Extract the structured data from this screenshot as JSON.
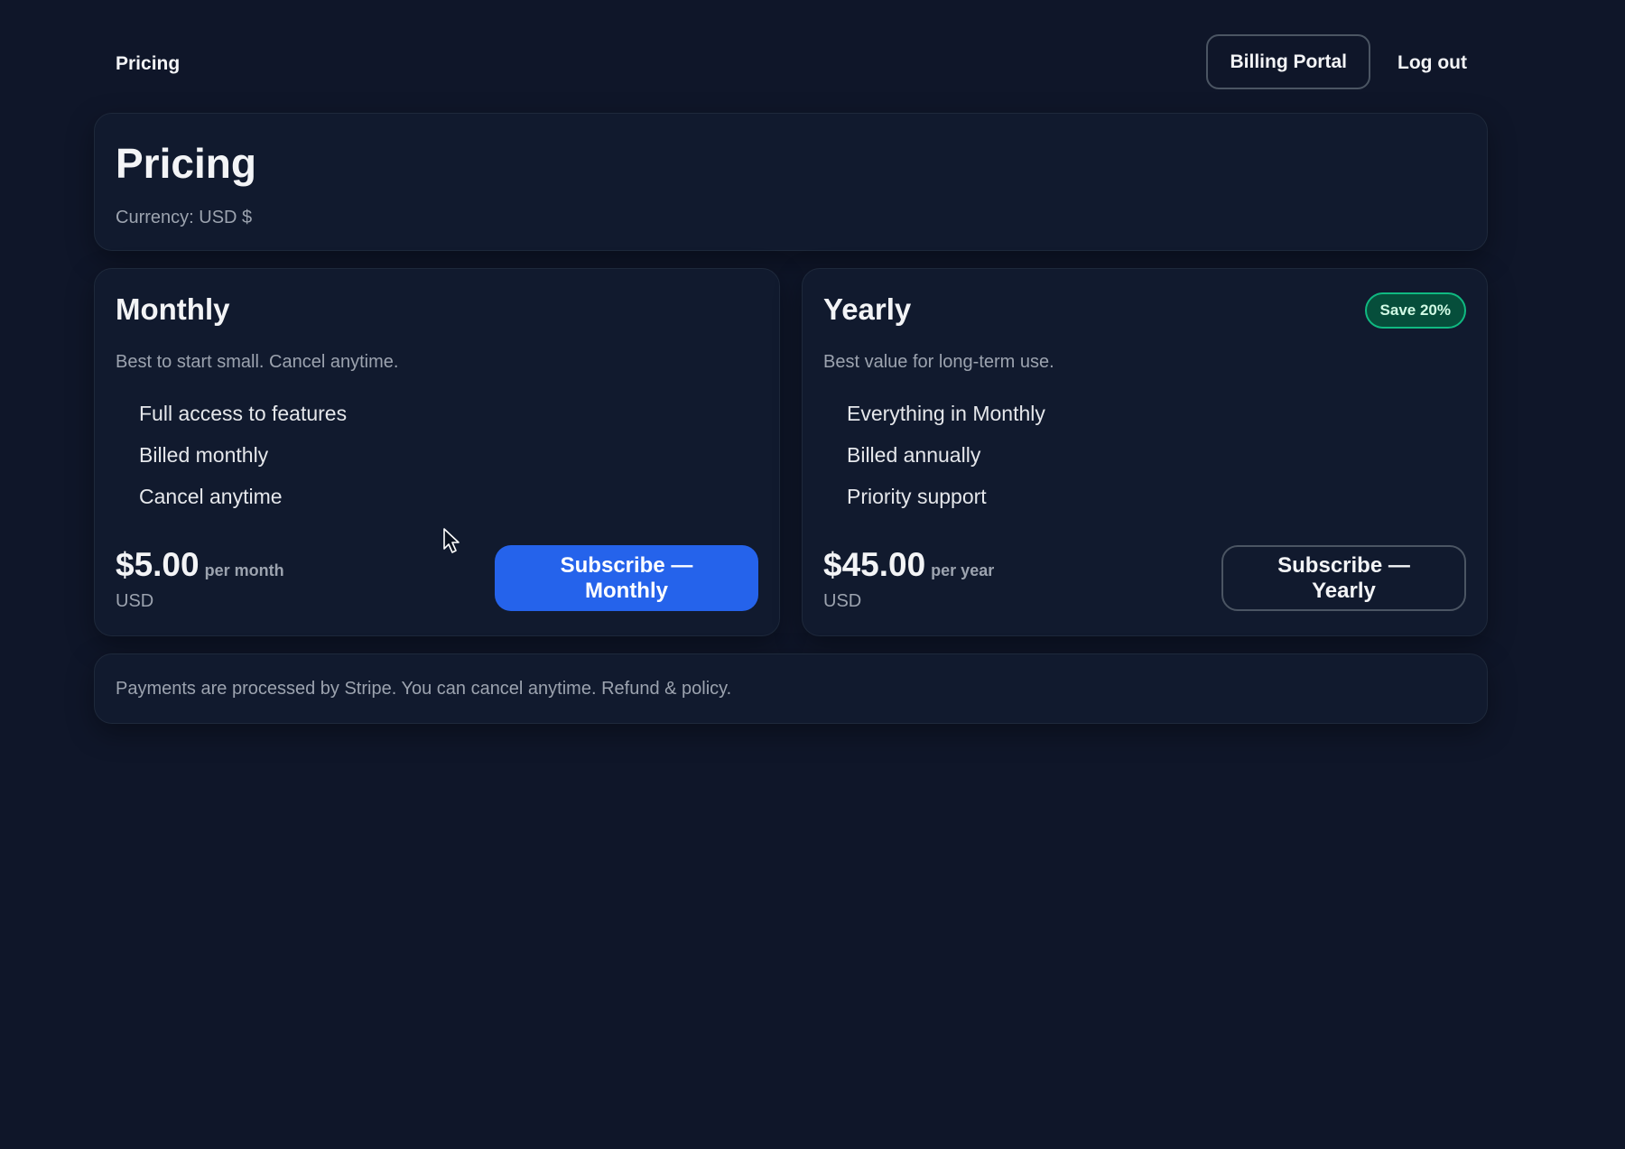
{
  "nav": {
    "brand": "Pricing",
    "billing_portal": "Billing Portal",
    "logout": "Log out"
  },
  "hero": {
    "title": "Pricing",
    "currency_label": "Currency: USD $"
  },
  "plans": [
    {
      "name": "Monthly",
      "description": "Best to start small. Cancel anytime.",
      "features": [
        "Full access to features",
        "Billed monthly",
        "Cancel anytime"
      ],
      "price": "$5.00",
      "period": "per month",
      "currency": "USD",
      "cta": "Subscribe — Monthly",
      "cta_style": "primary"
    },
    {
      "name": "Yearly",
      "badge": "Save 20%",
      "description": "Best value for long-term use.",
      "features": [
        "Everything in Monthly",
        "Billed annually",
        "Priority support"
      ],
      "price": "$45.00",
      "period": "per year",
      "currency": "USD",
      "cta": "Subscribe — Yearly",
      "cta_style": "outline"
    }
  ],
  "footer": {
    "note": "Payments are processed by Stripe. You can cancel anytime. Refund & policy."
  },
  "colors": {
    "background": "#0f1629",
    "card": "#111a2e",
    "primary": "#2563eb",
    "badge_bg": "#064e3b",
    "badge_border": "#10b981"
  },
  "icons": {
    "cursor": "mouse-pointer-icon"
  }
}
